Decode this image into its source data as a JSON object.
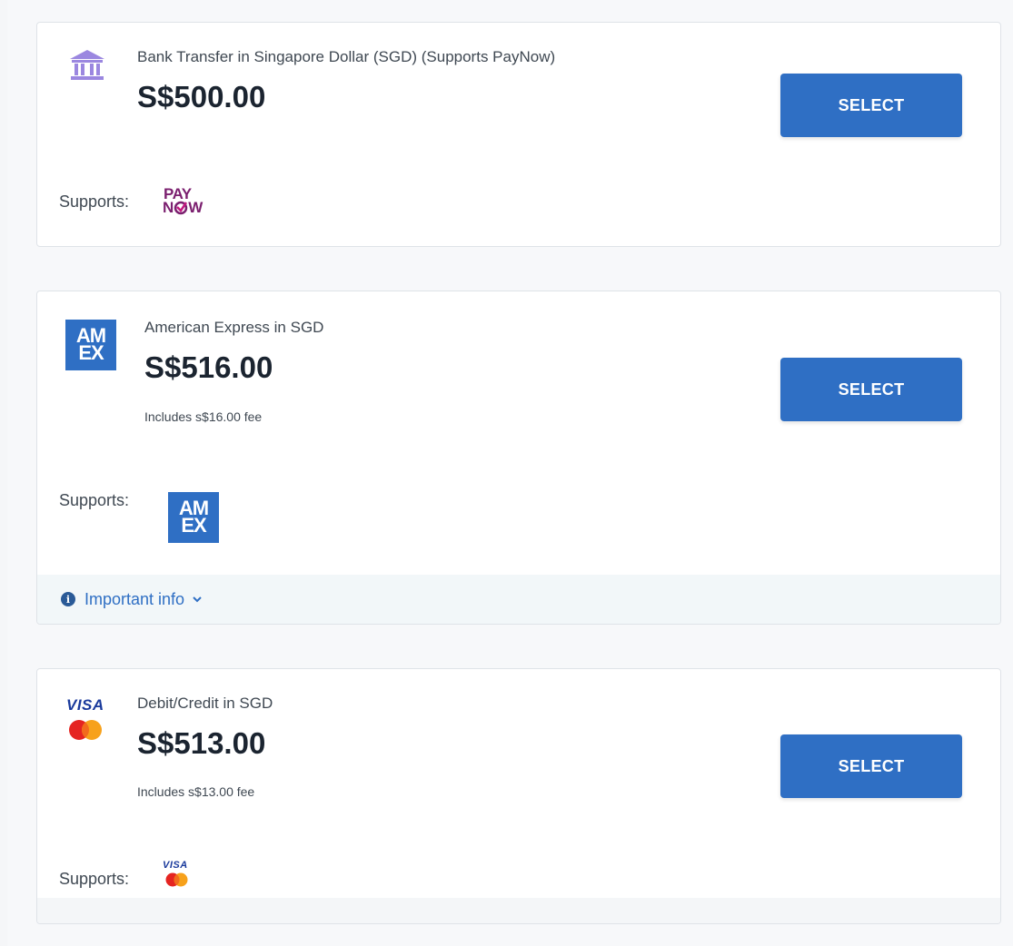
{
  "methods": [
    {
      "name": "Bank Transfer in Singapore Dollar (SGD) (Supports PayNow)",
      "price": "S$500.00",
      "fee": "",
      "select_label": "SELECT",
      "supports_label": "Supports:",
      "icon": "bank-icon",
      "supports_logos": [
        "paynow-logo"
      ],
      "paynow_top": "PAY",
      "paynow_bottom_left": "N",
      "paynow_bottom_right": "W"
    },
    {
      "name": "American Express in SGD",
      "price": "S$516.00",
      "fee": "Includes s$16.00 fee",
      "select_label": "SELECT",
      "supports_label": "Supports:",
      "icon": "amex-icon",
      "supports_logos": [
        "amex-logo"
      ],
      "amex_top": "AM",
      "amex_bottom": "EX",
      "important_info": "Important info"
    },
    {
      "name": "Debit/Credit in SGD",
      "price": "S$513.00",
      "fee": "Includes s$13.00 fee",
      "select_label": "SELECT",
      "supports_label": "Supports:",
      "icon": "visa-mastercard-icon",
      "supports_logos": [
        "visa-logo",
        "mastercard-logo"
      ],
      "visa_text": "VISA"
    }
  ],
  "colors": {
    "primary_button": "#2f6fc4",
    "bank_icon": "#9b87e0",
    "paynow": "#7b1f6f",
    "amex": "#2f6fc4",
    "visa": "#1a3a9c",
    "mastercard_red": "#e52421",
    "mastercard_orange": "#f7a11b",
    "info_link": "#2f6fc4",
    "important_bar_bg": "#f2f7f9"
  }
}
